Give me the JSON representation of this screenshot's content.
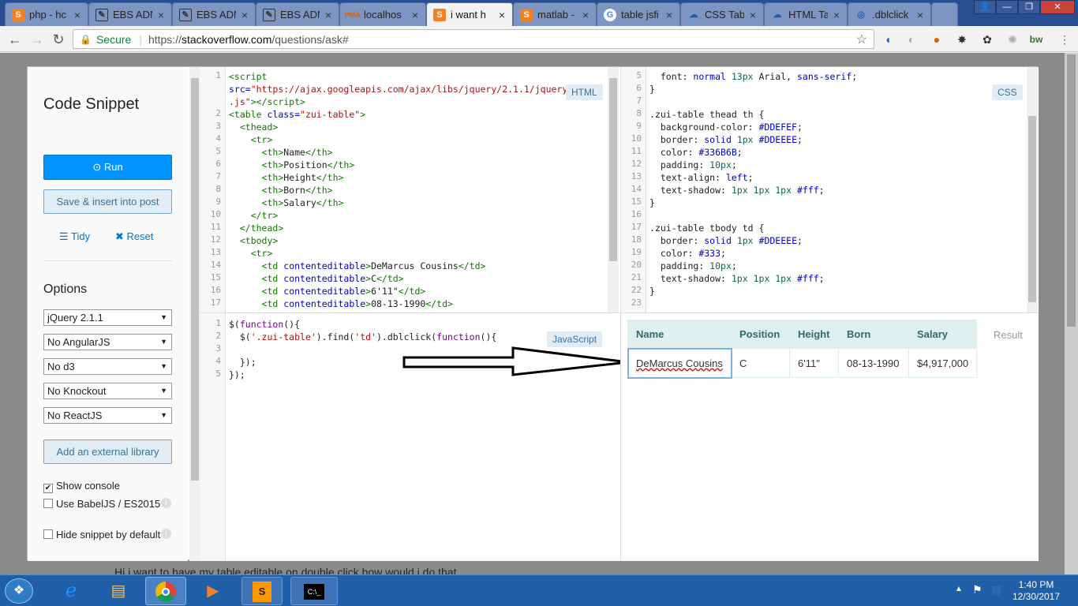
{
  "browser": {
    "tabs": [
      {
        "label": "php - hc",
        "icon": "stack-icon"
      },
      {
        "label": "EBS ADN",
        "icon": "ebs-icon"
      },
      {
        "label": "EBS ADN",
        "icon": "ebs-icon"
      },
      {
        "label": "EBS ADN",
        "icon": "ebs-icon"
      },
      {
        "label": "localhos",
        "icon": "pma-icon"
      },
      {
        "label": "i want h",
        "icon": "stack-icon"
      },
      {
        "label": "matlab -",
        "icon": "stack-icon"
      },
      {
        "label": "table jsfi",
        "icon": "google-icon"
      },
      {
        "label": "CSS Tab",
        "icon": "cloud-icon"
      },
      {
        "label": "HTML Ta",
        "icon": "cloud-icon"
      },
      {
        "label": ".dblclick",
        "icon": "jquery-icon"
      }
    ],
    "secure_label": "Secure",
    "url_prefix": "https://",
    "url_host": "stackoverflow.com",
    "url_path": "/questions/ask#"
  },
  "page": {
    "behind_text": "Hi i want to have my  table  editable  on  double  click  how would i do that"
  },
  "snippet": {
    "title": "Code Snippet",
    "run_label": "Run",
    "save_label": "Save & insert into post",
    "tidy_label": "Tidy",
    "reset_label": "Reset",
    "options_title": "Options",
    "selects": [
      "jQuery 2.1.1",
      "No AngularJS",
      "No d3",
      "No Knockout",
      "No ReactJS"
    ],
    "external_lib_label": "Add an external library",
    "checks": [
      {
        "label": "Show console",
        "checked": true
      },
      {
        "label": "Use BabelJS / ES2015",
        "checked": false
      },
      {
        "label": "Hide snippet by default",
        "checked": false
      }
    ],
    "html_label": "HTML",
    "css_label": "CSS",
    "js_label": "JavaScript",
    "result_label": "Result"
  },
  "result_table": {
    "headers": [
      "Name",
      "Position",
      "Height",
      "Born",
      "Salary"
    ],
    "row": [
      "DeMarcus Cousins",
      "C",
      "6'11\"",
      "08-13-1990",
      "$4,917,000"
    ]
  },
  "taskbar": {
    "time": "1:40 PM",
    "date": "12/30/2017"
  }
}
